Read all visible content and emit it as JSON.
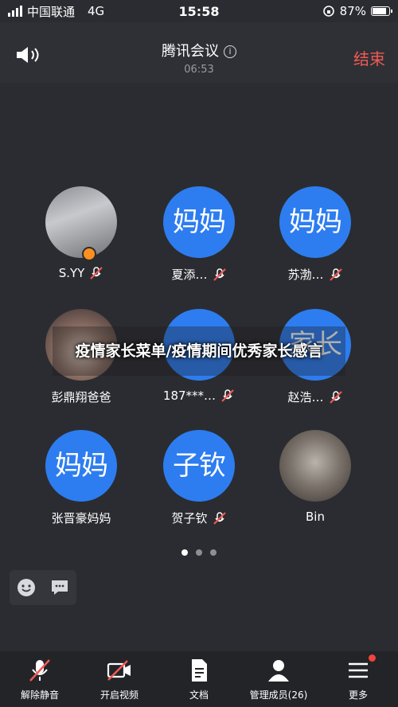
{
  "status_bar": {
    "carrier": "中国联通",
    "network": "4G",
    "time": "15:58",
    "battery_text": "87%",
    "battery_level": 0.87
  },
  "header": {
    "title": "腾讯会议",
    "info_icon": "info-circle-icon",
    "duration": "06:53",
    "end_label": "结束",
    "end_color": "#f05a55"
  },
  "participants": [
    {
      "name": "S.YY",
      "avatar_text": "",
      "avatar": "photo",
      "muted": true,
      "host": true
    },
    {
      "name": "夏添…",
      "avatar_text": "妈妈",
      "avatar": "blue",
      "muted": true
    },
    {
      "name": "苏渤…",
      "avatar_text": "妈妈",
      "avatar": "blue",
      "muted": true
    },
    {
      "name": "彭鼎翔爸爸",
      "avatar_text": "",
      "avatar": "photo",
      "muted": false
    },
    {
      "name": "187***…",
      "avatar_text": "",
      "avatar": "blue",
      "muted": true
    },
    {
      "name": "赵浩…",
      "avatar_text": "家长",
      "avatar": "blue",
      "muted": true
    },
    {
      "name": "张晋豪妈妈",
      "avatar_text": "妈妈",
      "avatar": "blue",
      "muted": false
    },
    {
      "name": "贺子钦",
      "avatar_text": "子钦",
      "avatar": "blue",
      "muted": true
    },
    {
      "name": "Bin",
      "avatar_text": "",
      "avatar": "photo",
      "muted": false
    }
  ],
  "overlay_caption": "疫情家长菜单/疫情期间优秀家长感言",
  "pagination": {
    "count": 3,
    "active": 1
  },
  "toolbar": {
    "items": [
      {
        "label": "解除静音",
        "icon": "mic-muted-icon"
      },
      {
        "label": "开启视频",
        "icon": "video-off-icon"
      },
      {
        "label": "文档",
        "icon": "document-icon"
      },
      {
        "label": "管理成员(26)",
        "icon": "members-icon"
      },
      {
        "label": "更多",
        "icon": "more-menu-icon"
      }
    ]
  },
  "colors": {
    "accent_blue": "#2d7df0",
    "background": "#2b2c31",
    "toolbar": "#232428"
  }
}
